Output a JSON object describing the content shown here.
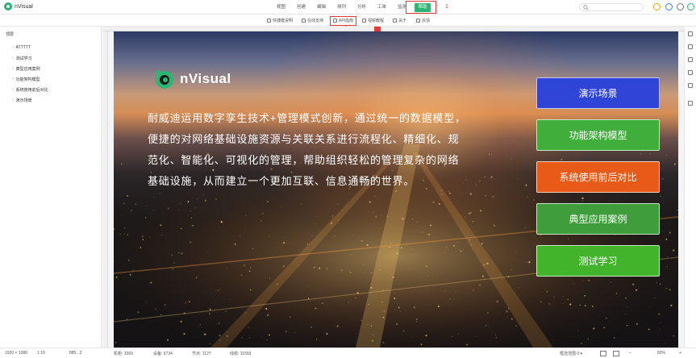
{
  "app": {
    "name": "nVisual"
  },
  "menu": {
    "items": [
      "视图",
      "创建",
      "编辑",
      "排列",
      "分析",
      "工单",
      "监测",
      "帮助"
    ],
    "annotation_1": "1"
  },
  "toolbar": {
    "items": [
      "快捷键说明",
      "在线支持",
      "API指南",
      "视频教程",
      "关于",
      "反馈"
    ],
    "annotation_2": "2"
  },
  "tree": {
    "root": "顶层",
    "items": [
      "ATTTTT",
      "测试学习",
      "典型应用案例",
      "功能架构模型",
      "系统使用前后对比",
      "演示场景"
    ]
  },
  "banner": {
    "logo_text": "nVisual",
    "description": "耐威迪运用数字孪生技术+管理模式创新，通过统一的数据模型，便捷的对网络基础设施资源与关联关系进行流程化、精细化、规范化、智能化、可视化的管理，帮助组织轻松的管理复杂的网络基础设施，从而建立一个更加互联、信息通畅的世界。",
    "cards": [
      {
        "label": "演示场景",
        "color": "#2f45d8"
      },
      {
        "label": "功能架构模型",
        "color": "#3fae3b"
      },
      {
        "label": "系统使用前后对比",
        "color": "#e85a17"
      },
      {
        "label": "典型应用案例",
        "color": "#3f9e3b"
      },
      {
        "label": "测试学习",
        "color": "#41b42c"
      }
    ]
  },
  "status": {
    "resolution": "1920 × 1080",
    "scale": "1:10",
    "coords": "885 , 2",
    "machines": "机柜: 3369",
    "devices": "设备: 6734",
    "nodes": "节点: 1127",
    "links": "线缆: 11593",
    "range": "框选范围 0 ▾",
    "zoom": "83%"
  },
  "colors": {
    "accent": "#2bb673",
    "annotation": "#e53935"
  }
}
